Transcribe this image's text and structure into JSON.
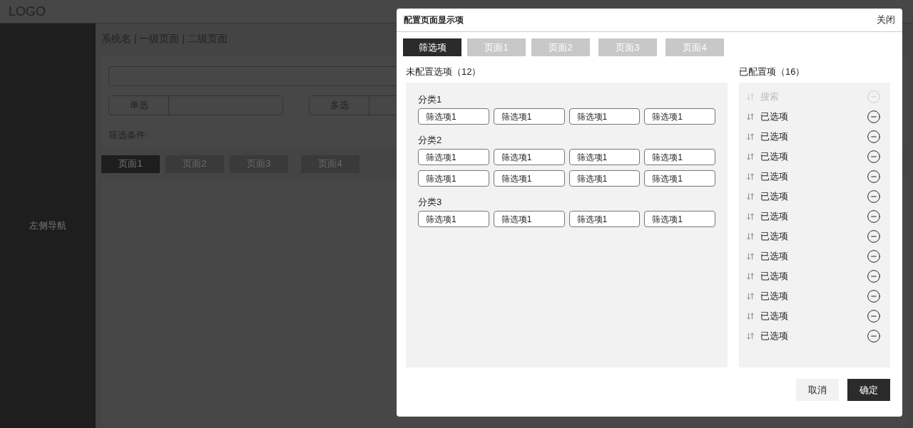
{
  "header": {
    "logo": "LOGO"
  },
  "sidebar": {
    "label": "左侧导航"
  },
  "main": {
    "breadcrumb": "系统名 | 一级页面 | 二级页面",
    "filters": [
      {
        "label": "单选"
      },
      {
        "label": "多选"
      }
    ],
    "conditions_label": "筛选条件:",
    "tabs": [
      {
        "label": "页面1",
        "selected": true
      },
      {
        "label": "页面2",
        "selected": false
      },
      {
        "label": "页面3",
        "selected": false
      },
      {
        "label": "页面4",
        "selected": false
      }
    ]
  },
  "dialog": {
    "title": "配置页面显示项",
    "close": "关闭",
    "tabs": [
      {
        "label": "筛选项",
        "selected": true
      },
      {
        "label": "页面1",
        "selected": false
      },
      {
        "label": "页面2",
        "selected": false
      },
      {
        "label": "页面3",
        "selected": false
      },
      {
        "label": "页面4",
        "selected": false
      }
    ],
    "unconfigured": {
      "title": "未配置选项（12）",
      "groups": [
        {
          "name": "分类1",
          "options": [
            "筛选项1",
            "筛选项1",
            "筛选项1",
            "筛选项1"
          ]
        },
        {
          "name": "分类2",
          "options": [
            "筛选项1",
            "筛选项1",
            "筛选项1",
            "筛选项1",
            "筛选项1",
            "筛选项1",
            "筛选项1",
            "筛选项1"
          ]
        },
        {
          "name": "分类3",
          "options": [
            "筛选项1",
            "筛选项1",
            "筛选项1",
            "筛选项1"
          ]
        }
      ]
    },
    "configured": {
      "title": "已配置项（16）",
      "items": [
        {
          "label": "搜索",
          "disabled": true
        },
        {
          "label": "已选项",
          "disabled": false
        },
        {
          "label": "已选项",
          "disabled": false
        },
        {
          "label": "已选项",
          "disabled": false
        },
        {
          "label": "已选项",
          "disabled": false
        },
        {
          "label": "已选项",
          "disabled": false
        },
        {
          "label": "已选项",
          "disabled": false
        },
        {
          "label": "已选项",
          "disabled": false
        },
        {
          "label": "已选项",
          "disabled": false
        },
        {
          "label": "已选项",
          "disabled": false
        },
        {
          "label": "已选项",
          "disabled": false
        },
        {
          "label": "已选项",
          "disabled": false
        },
        {
          "label": "已选项",
          "disabled": false
        }
      ]
    },
    "buttons": [
      {
        "label": "取消",
        "kind": "secondary"
      },
      {
        "label": "确定",
        "kind": "primary"
      }
    ]
  }
}
